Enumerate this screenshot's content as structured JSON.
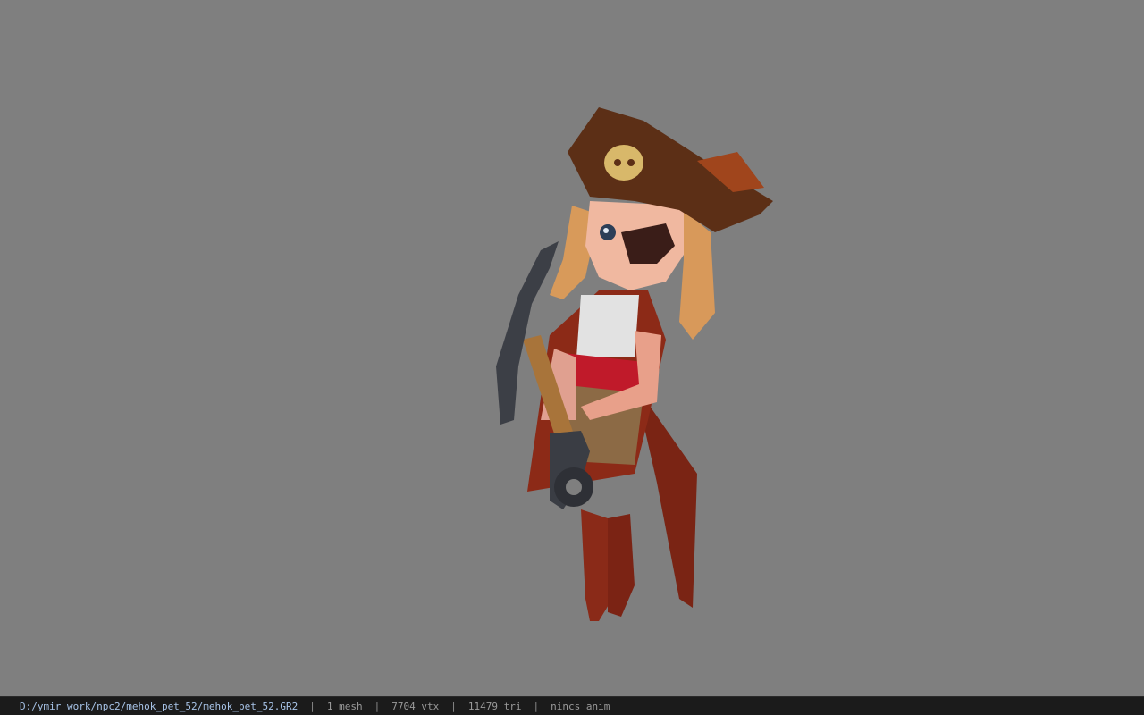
{
  "viewer": {
    "model_name": "pirate-girl-character-model",
    "background_color": "#7f7f7f"
  },
  "statusbar": {
    "file_path": "D:/ymir work/npc2/mehok_pet_52/mehok_pet_52.GR2",
    "separator": "|",
    "mesh_count": "1 mesh",
    "vertex_count": "7704 vtx",
    "triangle_count": "11479 tri",
    "anim_label": "nincs anim"
  }
}
